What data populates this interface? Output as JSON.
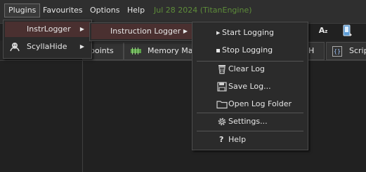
{
  "menubar": {
    "items": [
      "Plugins",
      "Favourites",
      "Options",
      "Help"
    ],
    "build_info": "Jul 28 2024 (TitanEngine)"
  },
  "toolbar": {
    "font_icon_label": "A",
    "font_icon_sub": "z"
  },
  "tabs": {
    "breakpoints": "points",
    "memory_map": "Memory Map",
    "handles_suffix": "H",
    "script": "Scrip"
  },
  "plugins_menu": {
    "items": [
      {
        "label": "InstrLogger",
        "icon": "none"
      },
      {
        "label": "ScyllaHide",
        "icon": "scylla-icon"
      }
    ]
  },
  "instrlogger_menu": {
    "items": [
      {
        "label": "Instruction Logger"
      }
    ]
  },
  "logger_menu": {
    "items": [
      {
        "label": "Start Logging",
        "icon": "play-icon"
      },
      {
        "label": "Stop Logging",
        "icon": "stop-icon"
      },
      {
        "label": "Clear Log",
        "icon": "trash-icon"
      },
      {
        "label": "Save Log...",
        "icon": "save-icon"
      },
      {
        "label": "Open Log Folder",
        "icon": "folder-icon"
      },
      {
        "label": "Settings...",
        "icon": "gear-icon"
      },
      {
        "label": "Help",
        "icon": "help-icon"
      }
    ]
  }
}
